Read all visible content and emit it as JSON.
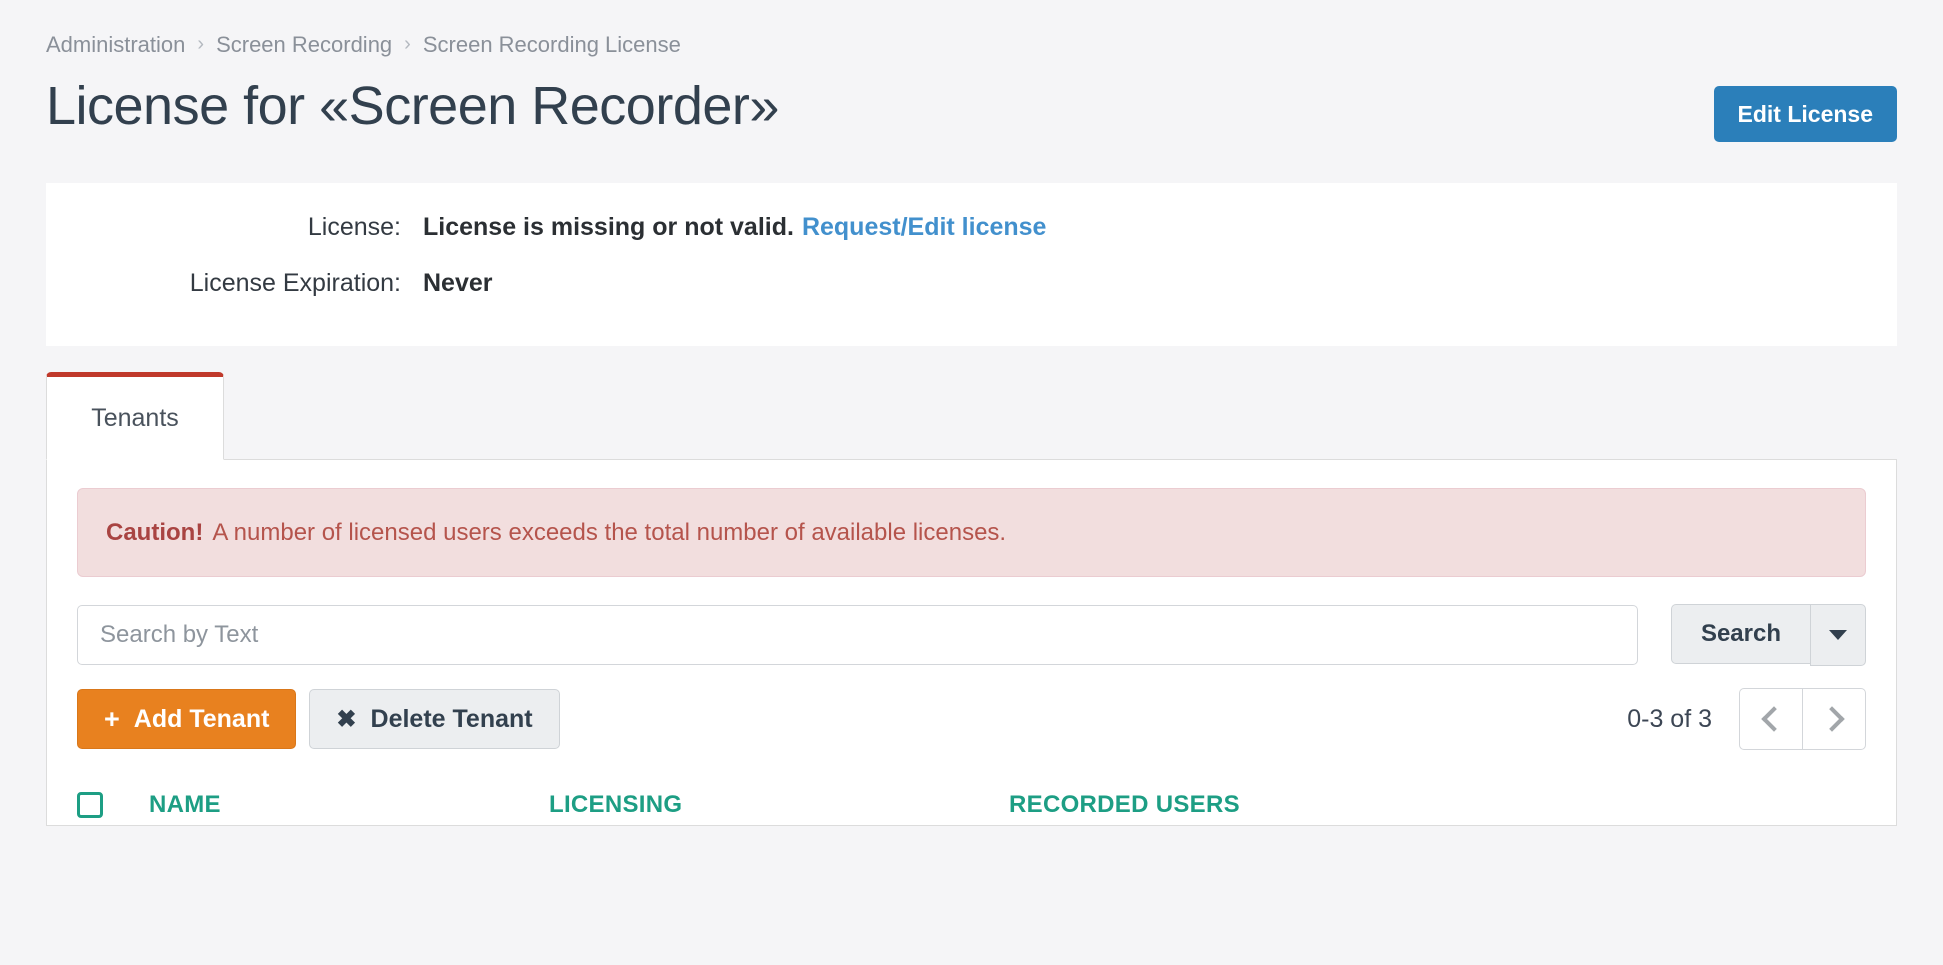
{
  "breadcrumb": {
    "separator": "›",
    "items": [
      {
        "label": "Administration"
      },
      {
        "label": "Screen Recording"
      },
      {
        "label": "Screen Recording License"
      }
    ]
  },
  "header": {
    "title": "License for «Screen Recorder»",
    "edit_license_label": "Edit License",
    "accent_blue": "#2b7fba"
  },
  "license_card": {
    "rows": [
      {
        "label": "License:",
        "value": "License is missing or not valid.",
        "link": "Request/Edit license"
      },
      {
        "label": "License Expiration:",
        "value": "Never",
        "link": ""
      }
    ]
  },
  "tabs": [
    {
      "label": "Tenants",
      "active": true,
      "accent": "#c0392b"
    }
  ],
  "alert": {
    "strong": "Caution!",
    "text": "A number of licensed users exceeds the total number of available licenses.",
    "background": "#f2dede",
    "text_color": "#b5544c"
  },
  "search": {
    "placeholder": "Search by Text",
    "value": "",
    "button_label": "Search",
    "dropdown_icon": "chevron-down-icon"
  },
  "actions": {
    "add_label": "Add Tenant",
    "add_glyph": "+",
    "add_color": "#e8811f",
    "delete_label": "Delete Tenant",
    "delete_glyph": "✖"
  },
  "pagination": {
    "range_label": "0-3 of 3",
    "prev_icon": "chevron-left-icon",
    "next_icon": "chevron-right-icon"
  },
  "table": {
    "header_color": "#1d9e84",
    "select_all_icon": "checkbox-icon",
    "columns": [
      {
        "label": "NAME"
      },
      {
        "label": "LICENSING"
      },
      {
        "label": "RECORDED USERS"
      }
    ]
  }
}
